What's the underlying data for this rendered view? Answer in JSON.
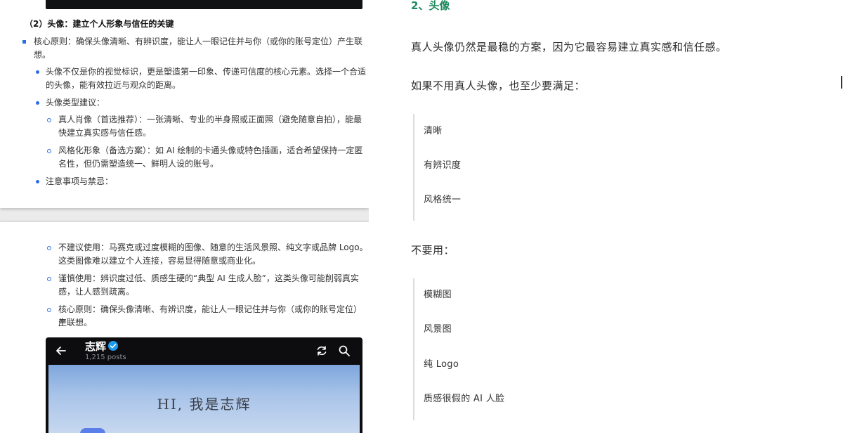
{
  "left": {
    "heading": "（2）头像：建立个人形象与信任的关键",
    "core_principle_1": {
      "line1": "核心原则：确保头像清晰、有辨识度，能让人一眼记住并与你（或你的账号定位）产生联",
      "line2": "想。"
    },
    "avatar_identity": {
      "line1": "头像不仅是你的视觉标识，更是塑造第一印象、传递可信度的核心元素。选择一个合适",
      "line2": "的头像，能有效拉近与观众的距离。"
    },
    "type_suggestion": "头像类型建议：",
    "real_portrait": {
      "line1": "真人肖像（首选推荐）：一张清晰、专业的半身照或正面照（避免随意自拍），能最",
      "line2": "快建立真实感与信任感。"
    },
    "stylized": {
      "line1": "风格化形象（备选方案）：如 AI 绘制的卡通头像或特色插画，适合希望保持一定匿",
      "line2": "名性，但仍需塑造统一、鲜明人设的账号。"
    },
    "notes": "注意事项与禁忌：",
    "not_recommended": {
      "line1": "不建议使用：马赛克或过度模糊的图像、随意的生活风景照、纯文字或品牌 Logo。",
      "line2": "这类图像难以建立个人连接，容易显得随意或商业化。"
    },
    "cautious": {
      "line1": "谨慎使用：辨识度过低、质感生硬的“典型 AI 生成人脸”，这类头像可能削弱真实",
      "line2": "感，让人感到疏离。"
    },
    "core_principle_2": {
      "line1": "核心原则：确保头像清晰、有辨识度，能让人一眼记住并与你（或你的账号定位）产",
      "line2": "生联想。"
    },
    "phone": {
      "name": "志辉",
      "posts": "1,215 posts",
      "banner_text": "HI, 我是志辉",
      "icons": [
        "back-arrow-icon",
        "verified-badge-icon",
        "refresh-icon",
        "search-icon"
      ]
    }
  },
  "right": {
    "heading": "2、头像",
    "para1": "真人头像仍然是最稳的方案，因为它最容易建立真实感和信任感。",
    "para2": "如果不用真人头像，也至少要满足：",
    "must_items": [
      "清晰",
      "有辨识度",
      "风格统一"
    ],
    "para3": "不要用：",
    "avoid_items": [
      "模糊图",
      "风景图",
      "纯 Logo",
      "质感很假的 AI 人脸"
    ]
  },
  "colors": {
    "accent_blue": "#2b6de8",
    "heading_green": "#1e8a5e",
    "verified_blue": "#1d9bf0"
  }
}
